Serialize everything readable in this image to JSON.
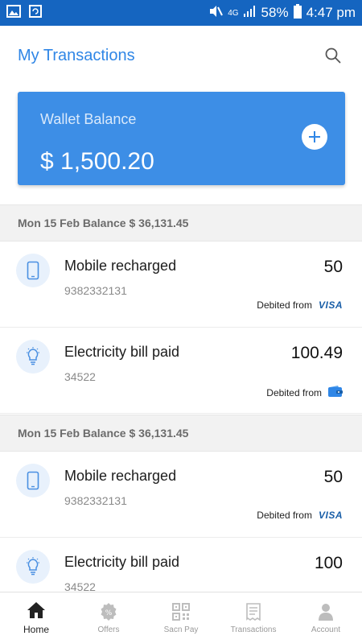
{
  "status_bar": {
    "network": "4G",
    "battery": "58%",
    "time": "4:47 pm"
  },
  "header": {
    "title": "My Transactions"
  },
  "wallet": {
    "label": "Wallet Balance",
    "amount": "$ 1,500.20"
  },
  "sections": [
    {
      "date_header": "Mon 15 Feb Balance $ 36,131.45",
      "transactions": [
        {
          "icon": "mobile-icon",
          "title": "Mobile recharged",
          "sub": "9382332131",
          "amount": "50",
          "debited_from": "Debited from",
          "method": "VISA"
        },
        {
          "icon": "bulb-icon",
          "title": "Electricity bill paid",
          "sub": "34522",
          "amount": "100.49",
          "debited_from": "Debited from",
          "method": "wallet"
        }
      ]
    },
    {
      "date_header": "Mon 15 Feb Balance $ 36,131.45",
      "transactions": [
        {
          "icon": "mobile-icon",
          "title": "Mobile recharged",
          "sub": "9382332131",
          "amount": "50",
          "debited_from": "Debited from",
          "method": "VISA"
        },
        {
          "icon": "bulb-icon",
          "title": "Electricity bill paid",
          "sub": "34522",
          "amount": "100"
        }
      ]
    }
  ],
  "bottom_nav": [
    {
      "label": "Home",
      "icon": "home-icon",
      "active": true
    },
    {
      "label": "Offers",
      "icon": "offers-icon"
    },
    {
      "label": "Sacn  Pay",
      "icon": "qr-icon"
    },
    {
      "label": "Transactions",
      "icon": "receipt-icon"
    },
    {
      "label": "Account",
      "icon": "user-icon"
    }
  ],
  "colors": {
    "status_bar": "#1565c0",
    "accent": "#2f86e6",
    "wallet_card": "#3d8ee6"
  }
}
